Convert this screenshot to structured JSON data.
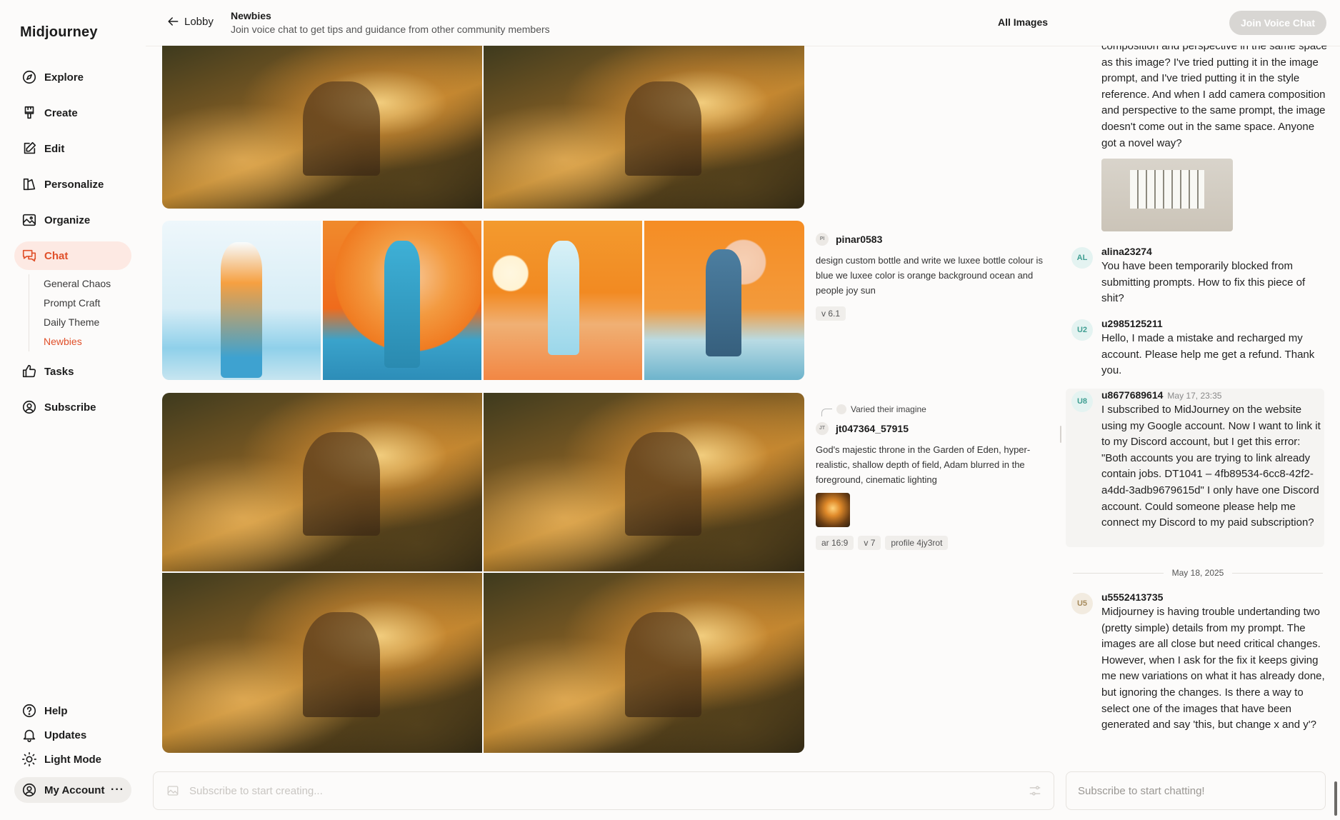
{
  "app": {
    "title": "Midjourney"
  },
  "nav": {
    "items": [
      {
        "label": "Explore",
        "icon": "compass-icon"
      },
      {
        "label": "Create",
        "icon": "brush-icon"
      },
      {
        "label": "Edit",
        "icon": "pencil-square-icon"
      },
      {
        "label": "Personalize",
        "icon": "personalize-icon"
      },
      {
        "label": "Organize",
        "icon": "image-icon"
      },
      {
        "label": "Chat",
        "icon": "chat-bubbles-icon",
        "active": true
      },
      {
        "label": "Tasks",
        "icon": "thumbs-up-icon"
      },
      {
        "label": "Subscribe",
        "icon": "user-circle-icon"
      }
    ],
    "chat_channels": [
      "General Chaos",
      "Prompt Craft",
      "Daily Theme",
      "Newbies"
    ],
    "active_channel": "Newbies",
    "bottom": [
      {
        "label": "Help",
        "icon": "question-icon"
      },
      {
        "label": "Updates",
        "icon": "bell-icon"
      },
      {
        "label": "Light Mode",
        "icon": "sun-icon"
      }
    ],
    "account": {
      "label": "My Account",
      "more": "···"
    }
  },
  "header": {
    "back_label": "Lobby",
    "channel_title": "Newbies",
    "channel_desc": "Join voice chat to get tips and guidance from other community members",
    "all_images": "All Images",
    "voice_button": "Join Voice Chat"
  },
  "feed": [
    {
      "user": "pinar0583",
      "avatar": "PI",
      "prompt": "design custom bottle and write we luxee bottle colour is blue we luxee color is orange background ocean and people joy sun",
      "chips": [
        "v 6.1"
      ]
    },
    {
      "varied_label": "Varied their imagine",
      "user": "jt047364_57915",
      "avatar": "JT",
      "prompt": "God's majestic throne in the Garden of Eden, hyper-realistic, shallow depth of field, Adam blurred in the foreground, cinematic lighting",
      "chips": [
        "ar 16:9",
        "v 7",
        "profile 4jy3rot"
      ]
    }
  ],
  "chat": {
    "messages": [
      {
        "text": "composition and perspective in the same space as this image? I've tried putting it in the image prompt, and I've tried putting it in the style reference. And when I add camera composition and perspective to the same prompt, the image doesn't come out in the same space. Anyone got a novel way?"
      },
      {
        "initials": "AL",
        "name": "alina23274",
        "text": "You have been temporarily blocked from submitting prompts. How to fix this piece of shit?"
      },
      {
        "initials": "U2",
        "name": "u2985125211",
        "text": "Hello, I made a mistake and recharged my account. Please help me get a refund. Thank you."
      },
      {
        "initials": "U8",
        "name": "u8677689614",
        "time": "May 17, 23:35",
        "text": "I subscribed to MidJourney on the website using my Google account. Now I want to link it to my Discord account, but I get this error: \"Both accounts you are trying to link already contain jobs. DT1041 – 4fb89534-6cc8-42f2-a4dd-3adb9679615d\" I only have one Discord account. Could someone please help me connect my Discord to my paid subscription?"
      },
      {
        "initials": "U5",
        "name": "u5552413735",
        "text": "Midjourney is having trouble undertanding two (pretty simple) details from my prompt. The images are all close but need critical changes. However, when I ask for the fix it keeps giving me new variations on what it has already done, but ignoring the changes. Is there a way to select one of the images that have been generated and say 'this, but change x and y'?"
      }
    ],
    "date_separator": "May 18, 2025",
    "input_placeholder": "Subscribe to start chatting!"
  },
  "prompt_bar": {
    "placeholder": "Subscribe to start creating..."
  },
  "colors": {
    "accent": "#e0502a",
    "active_bg": "#fde9e3",
    "voice_btn": "#d8d6d3"
  }
}
